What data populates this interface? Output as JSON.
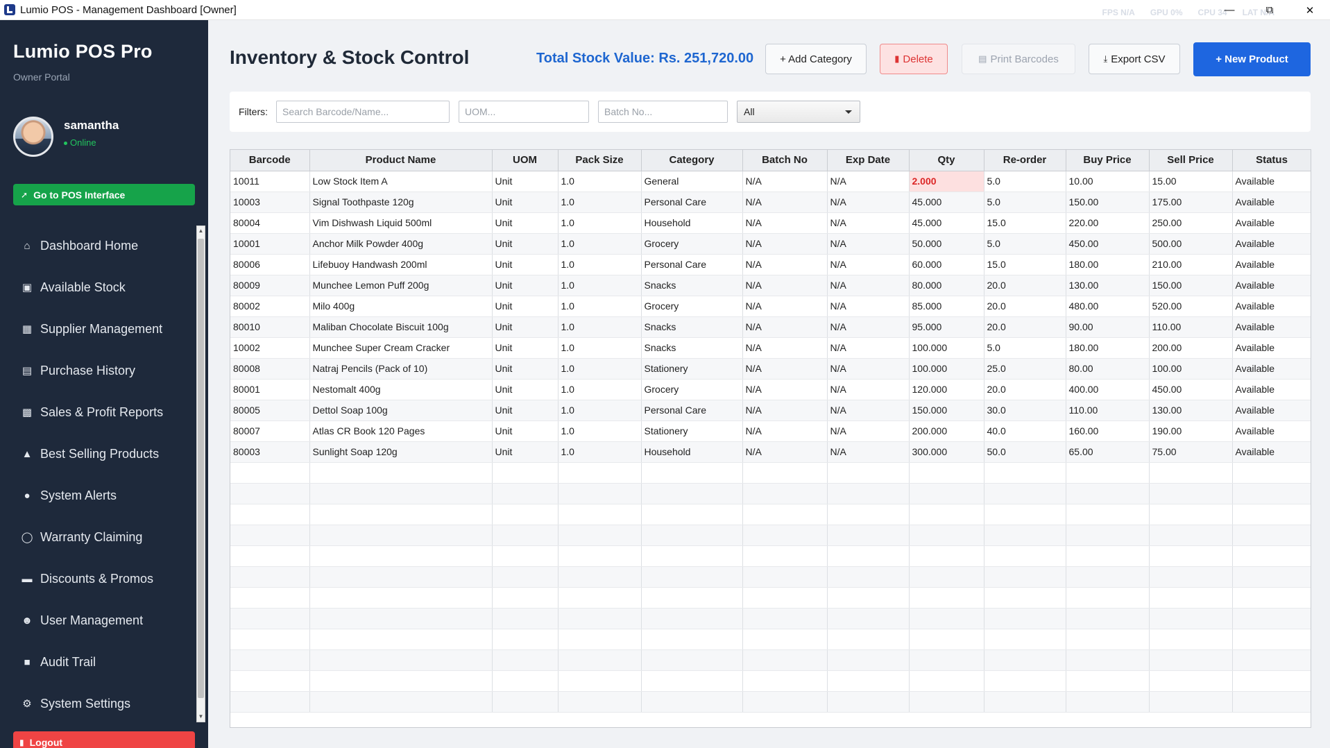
{
  "window": {
    "title": "Lumio POS - Management Dashboard [Owner]",
    "stats": [
      "FPS N/A",
      "GPU 0%",
      "CPU 34",
      "LAT N/A"
    ],
    "minimize": "—",
    "restore": "⧉",
    "close": "✕"
  },
  "sidebar": {
    "brand": "Lumio POS Pro",
    "subtitle": "Owner Portal",
    "user": {
      "name": "samantha",
      "status": "Online"
    },
    "pos_button": "Go to POS Interface",
    "items": [
      {
        "label": "Dashboard Home",
        "icon": "home-icon"
      },
      {
        "label": "Available Stock",
        "icon": "box-icon"
      },
      {
        "label": "Supplier Management",
        "icon": "building-icon"
      },
      {
        "label": "Purchase History",
        "icon": "receipt-icon"
      },
      {
        "label": "Sales & Profit Reports",
        "icon": "bar-chart-icon"
      },
      {
        "label": "Best Selling Products",
        "icon": "trophy-icon"
      },
      {
        "label": "System Alerts",
        "icon": "bell-icon"
      },
      {
        "label": "Warranty Claiming",
        "icon": "shield-icon"
      },
      {
        "label": "Discounts & Promos",
        "icon": "ticket-icon"
      },
      {
        "label": "User Management",
        "icon": "users-icon"
      },
      {
        "label": "Audit Trail",
        "icon": "truck-icon"
      },
      {
        "label": "System Settings",
        "icon": "gear-icon"
      }
    ],
    "logout": "Logout"
  },
  "header": {
    "title": "Inventory & Stock Control",
    "total_stock_value": "Total Stock Value: Rs. 251,720.00",
    "buttons": {
      "add_category": "+ Add Category",
      "delete": "Delete",
      "print_barcodes": "Print Barcodes",
      "export_csv": "Export CSV",
      "new_product": "+ New Product"
    }
  },
  "filters": {
    "label": "Filters:",
    "search_placeholder": "Search Barcode/Name...",
    "uom_placeholder": "UOM...",
    "batch_placeholder": "Batch No...",
    "category_value": "All"
  },
  "table": {
    "columns": [
      "Barcode",
      "Product Name",
      "UOM",
      "Pack Size",
      "Category",
      "Batch No",
      "Exp Date",
      "Qty",
      "Re-order",
      "Buy Price",
      "Sell Price",
      "Status"
    ],
    "rows": [
      [
        "10011",
        "Low Stock Item A",
        "Unit",
        "1.0",
        "General",
        "N/A",
        "N/A",
        "2.000",
        "5.0",
        "10.00",
        "15.00",
        "Available"
      ],
      [
        "10003",
        "Signal Toothpaste 120g",
        "Unit",
        "1.0",
        "Personal Care",
        "N/A",
        "N/A",
        "45.000",
        "5.0",
        "150.00",
        "175.00",
        "Available"
      ],
      [
        "80004",
        "Vim Dishwash Liquid 500ml",
        "Unit",
        "1.0",
        "Household",
        "N/A",
        "N/A",
        "45.000",
        "15.0",
        "220.00",
        "250.00",
        "Available"
      ],
      [
        "10001",
        "Anchor Milk Powder 400g",
        "Unit",
        "1.0",
        "Grocery",
        "N/A",
        "N/A",
        "50.000",
        "5.0",
        "450.00",
        "500.00",
        "Available"
      ],
      [
        "80006",
        "Lifebuoy Handwash 200ml",
        "Unit",
        "1.0",
        "Personal Care",
        "N/A",
        "N/A",
        "60.000",
        "15.0",
        "180.00",
        "210.00",
        "Available"
      ],
      [
        "80009",
        "Munchee Lemon Puff 200g",
        "Unit",
        "1.0",
        "Snacks",
        "N/A",
        "N/A",
        "80.000",
        "20.0",
        "130.00",
        "150.00",
        "Available"
      ],
      [
        "80002",
        "Milo 400g",
        "Unit",
        "1.0",
        "Grocery",
        "N/A",
        "N/A",
        "85.000",
        "20.0",
        "480.00",
        "520.00",
        "Available"
      ],
      [
        "80010",
        "Maliban Chocolate Biscuit 100g",
        "Unit",
        "1.0",
        "Snacks",
        "N/A",
        "N/A",
        "95.000",
        "20.0",
        "90.00",
        "110.00",
        "Available"
      ],
      [
        "10002",
        "Munchee Super Cream Cracker",
        "Unit",
        "1.0",
        "Snacks",
        "N/A",
        "N/A",
        "100.000",
        "5.0",
        "180.00",
        "200.00",
        "Available"
      ],
      [
        "80008",
        "Natraj Pencils (Pack of 10)",
        "Unit",
        "1.0",
        "Stationery",
        "N/A",
        "N/A",
        "100.000",
        "25.0",
        "80.00",
        "100.00",
        "Available"
      ],
      [
        "80001",
        "Nestomalt 400g",
        "Unit",
        "1.0",
        "Grocery",
        "N/A",
        "N/A",
        "120.000",
        "20.0",
        "400.00",
        "450.00",
        "Available"
      ],
      [
        "80005",
        "Dettol Soap 100g",
        "Unit",
        "1.0",
        "Personal Care",
        "N/A",
        "N/A",
        "150.000",
        "30.0",
        "110.00",
        "130.00",
        "Available"
      ],
      [
        "80007",
        "Atlas CR Book 120 Pages",
        "Unit",
        "1.0",
        "Stationery",
        "N/A",
        "N/A",
        "200.000",
        "40.0",
        "160.00",
        "190.00",
        "Available"
      ],
      [
        "80003",
        "Sunlight Soap 120g",
        "Unit",
        "1.0",
        "Household",
        "N/A",
        "N/A",
        "300.000",
        "50.0",
        "65.00",
        "75.00",
        "Available"
      ]
    ],
    "low_stock_rows": [
      0
    ]
  },
  "colors": {
    "sidebar_bg": "#1e293b",
    "accent": "#1e66e0",
    "success": "#16a34a",
    "danger": "#ef4444",
    "low_stock": "#dc2626"
  }
}
